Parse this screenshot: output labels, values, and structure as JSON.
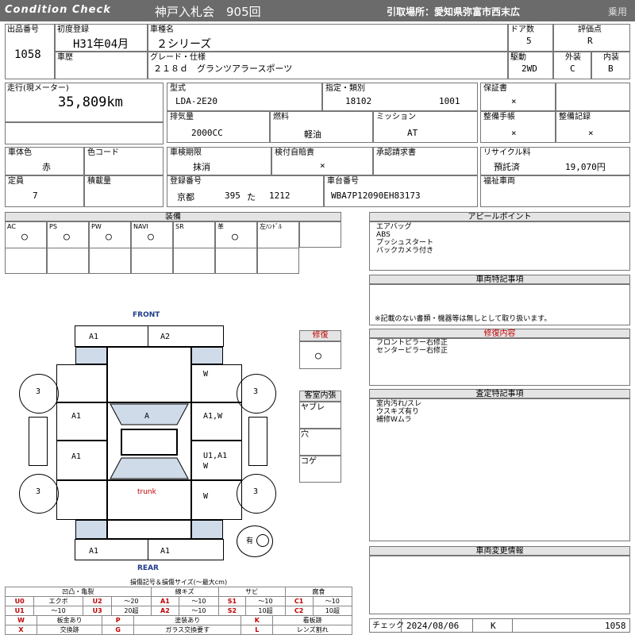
{
  "header": {
    "logo": "Condition Check",
    "auction": "神戸入札会　905回",
    "pickup": "引取場所：愛知県弥富市西末広",
    "category": "乗用"
  },
  "vehicle": {
    "lot_label": "出品番号",
    "lot": "1058",
    "first_reg_label": "初度登録",
    "first_reg": "H31年04月",
    "model_name_label": "車種名",
    "model_name": "２シリーズ",
    "doors_label": "ドア数",
    "doors": "5",
    "rating_label": "評価点",
    "rating": "R",
    "history_label": "車歴",
    "grade_label": "グレード・仕様",
    "grade": "２１８ｄ　グランツアラースポーツ",
    "drive_label": "駆動",
    "drive": "2WD",
    "exterior_label": "外装",
    "exterior": "C",
    "interior_label": "内装",
    "interior": "B"
  },
  "spec": {
    "mileage_label": "走行(現メーター)",
    "mileage": "35,809km",
    "type_label": "型式",
    "type": "LDA-2E20",
    "designation_label": "指定・類別",
    "designation": "18102",
    "classification": "1001",
    "warranty_label": "保証書",
    "warranty": "×",
    "displacement_label": "排気量",
    "displacement": "2000CC",
    "fuel_label": "燃料",
    "fuel": "軽油",
    "mission_label": "ミッション",
    "mission": "AT",
    "manual_label": "整備手帳",
    "manual": "×",
    "service_record_label": "整備記録",
    "service_record": "×",
    "body_color_label": "車体色",
    "body_color": "赤",
    "color_code_label": "色コード",
    "inspection_label": "車検期限",
    "inspection": "抹消",
    "insurance_label": "検付自賠責",
    "insurance": "×",
    "approval_label": "承認請求書",
    "recycle_label": "リサイクル料",
    "recycle_status": "預託済",
    "recycle_fee": "19,070円",
    "capacity_label": "定員",
    "capacity": "7",
    "load_label": "積載量",
    "plate_label": "登録番号",
    "plate_area": "京都",
    "plate_class": "395",
    "plate_kana": "た",
    "plate_num": "1212",
    "chassis_label": "車台番号",
    "chassis": "WBA7P12090EH83173",
    "welfare_label": "福祉車両"
  },
  "equipment": {
    "title": "装備",
    "items": [
      {
        "label": "AC",
        "value": "○"
      },
      {
        "label": "PS",
        "value": "○"
      },
      {
        "label": "PW",
        "value": "○"
      },
      {
        "label": "NAVI",
        "value": "○"
      },
      {
        "label": "SR",
        "value": ""
      },
      {
        "label": "革",
        "value": "○"
      },
      {
        "label": "左ﾊﾝﾄﾞﾙ",
        "value": ""
      }
    ]
  },
  "appeal": {
    "title": "アピールポイント",
    "lines": [
      "エアバッグ",
      "ABS",
      "プッシュスタート",
      "バックカメラ付き"
    ]
  },
  "special": {
    "title": "車両特記事項",
    "note": "※記載のない書類・機器等は無しとして取り扱います。"
  },
  "repair_content": {
    "title": "修復内容",
    "lines": [
      "フロントピラー右修正",
      "センターピラー右修正"
    ]
  },
  "inspection_notes": {
    "title": "査定特記事項",
    "lines": [
      "室内汚れ/スレ",
      "ウスキズ有り",
      "補修Wムラ"
    ]
  },
  "change_info": {
    "title": "車両変更情報"
  },
  "diagram": {
    "front": "FRONT",
    "rear": "REAR",
    "trunk": "trunk",
    "marks": {
      "front_left": "A1",
      "front_right": "A2",
      "door_fl": "A1",
      "door_rl": "A1",
      "roof": "A",
      "door_fr": "A1,W",
      "door_rr": "U1,A1",
      "pillar_fr": "W",
      "pillar_rr1": "W",
      "pillar_rr2": "W",
      "rear_left": "A1",
      "rear_right": "A1",
      "tire_fl": "3",
      "tire_fr": "3",
      "tire_rl": "3",
      "tire_rr": "3"
    },
    "spare_label": "有"
  },
  "repair": {
    "title": "修復",
    "value": "○"
  },
  "interior_damage": {
    "title": "客室内張",
    "items": [
      "ヤブレ",
      "穴",
      "コゲ"
    ]
  },
  "legend": {
    "title": "損傷記号＆損傷サイズ(〜最大cm)",
    "groups": [
      "凹凸・亀裂",
      "線キズ",
      "サビ",
      "腐食"
    ],
    "rows": [
      [
        {
          "c": "U0",
          "d": "エクボ"
        },
        {
          "c": "U2",
          "d": "〜20"
        },
        {
          "c": "A1",
          "d": "〜10"
        },
        {
          "c": "S1",
          "d": "〜10"
        },
        {
          "c": "C1",
          "d": "〜10"
        }
      ],
      [
        {
          "c": "U1",
          "d": "〜10"
        },
        {
          "c": "U3",
          "d": "20超"
        },
        {
          "c": "A2",
          "d": "〜10"
        },
        {
          "c": "S2",
          "d": "10超"
        },
        {
          "c": "C2",
          "d": "10超"
        }
      ]
    ],
    "rows2": [
      [
        {
          "c": "W",
          "d": "板金あり"
        },
        {
          "c": "P",
          "d": "塗装あり"
        },
        {
          "c": "K",
          "d": "看板跡"
        }
      ],
      [
        {
          "c": "X",
          "d": "交換跡"
        },
        {
          "c": "G",
          "d": "ガラス交換要す"
        },
        {
          "c": "L",
          "d": "レンズ割れ"
        }
      ]
    ]
  },
  "check": {
    "label": "チェック",
    "date": "2024/08/06",
    "inspector": "K",
    "number": "1058"
  }
}
